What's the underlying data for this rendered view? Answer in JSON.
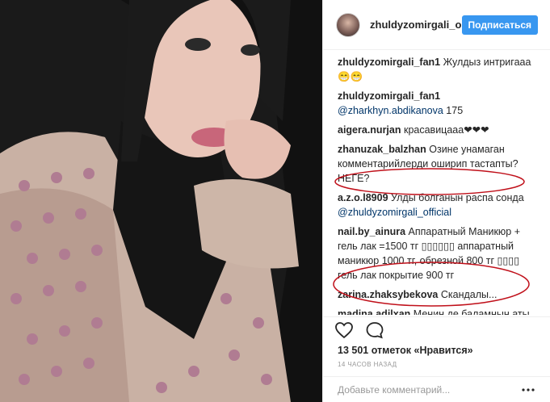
{
  "header": {
    "username": "zhuldyzomirgali_o",
    "follow_label": "Подписаться"
  },
  "comments": [
    {
      "user": "zhuldyzomirgali_fan1",
      "text": "Жулдыз интригааа😁😁",
      "mention": ""
    },
    {
      "user": "zhuldyzomirgali_fan1",
      "text": " 175",
      "mention": "@zharkhyn.abdikanova"
    },
    {
      "user": "aigera.nurjan",
      "text": "красавицааа❤❤❤",
      "mention": ""
    },
    {
      "user": "zhanuzak_balzhan",
      "text": "Озине унамаган комментарийлерди оширип тастапты? НЕГЕ?",
      "mention": ""
    },
    {
      "user": "a.z.o.l8909",
      "text": "Улды болганын распа сонда",
      "mention": "@zhuldyzomirgali_official"
    },
    {
      "user": "nail.by_ainura",
      "text": "Аппаратный Маникюр + гель лак =1500 тг ▯▯▯▯▯▯ аппаратный маникюр 1000 тг, обрезной 800 тг ▯▯▯▯ гель лак покрытие 900 тг",
      "mention": ""
    },
    {
      "user": "zarina.zhaksybekova",
      "text": "Скандалы...",
      "mention": ""
    },
    {
      "user": "madina.adilxan",
      "text": "Менин де баламнын аты САНЖАР. Аттас екен балаларымыз. Бауы берик болсын🙏",
      "mention": ""
    }
  ],
  "likes": "13 501 отметок «Нравится»",
  "timestamp": "14 ЧАСОВ НАЗАД",
  "add_comment_placeholder": "Добавьте комментарий...",
  "icons": {
    "like": "heart-icon",
    "comment": "comment-bubble-icon",
    "more": "more-dots-icon"
  },
  "colors": {
    "follow_button": "#3897f0",
    "annotation_circle": "#c0101a"
  }
}
